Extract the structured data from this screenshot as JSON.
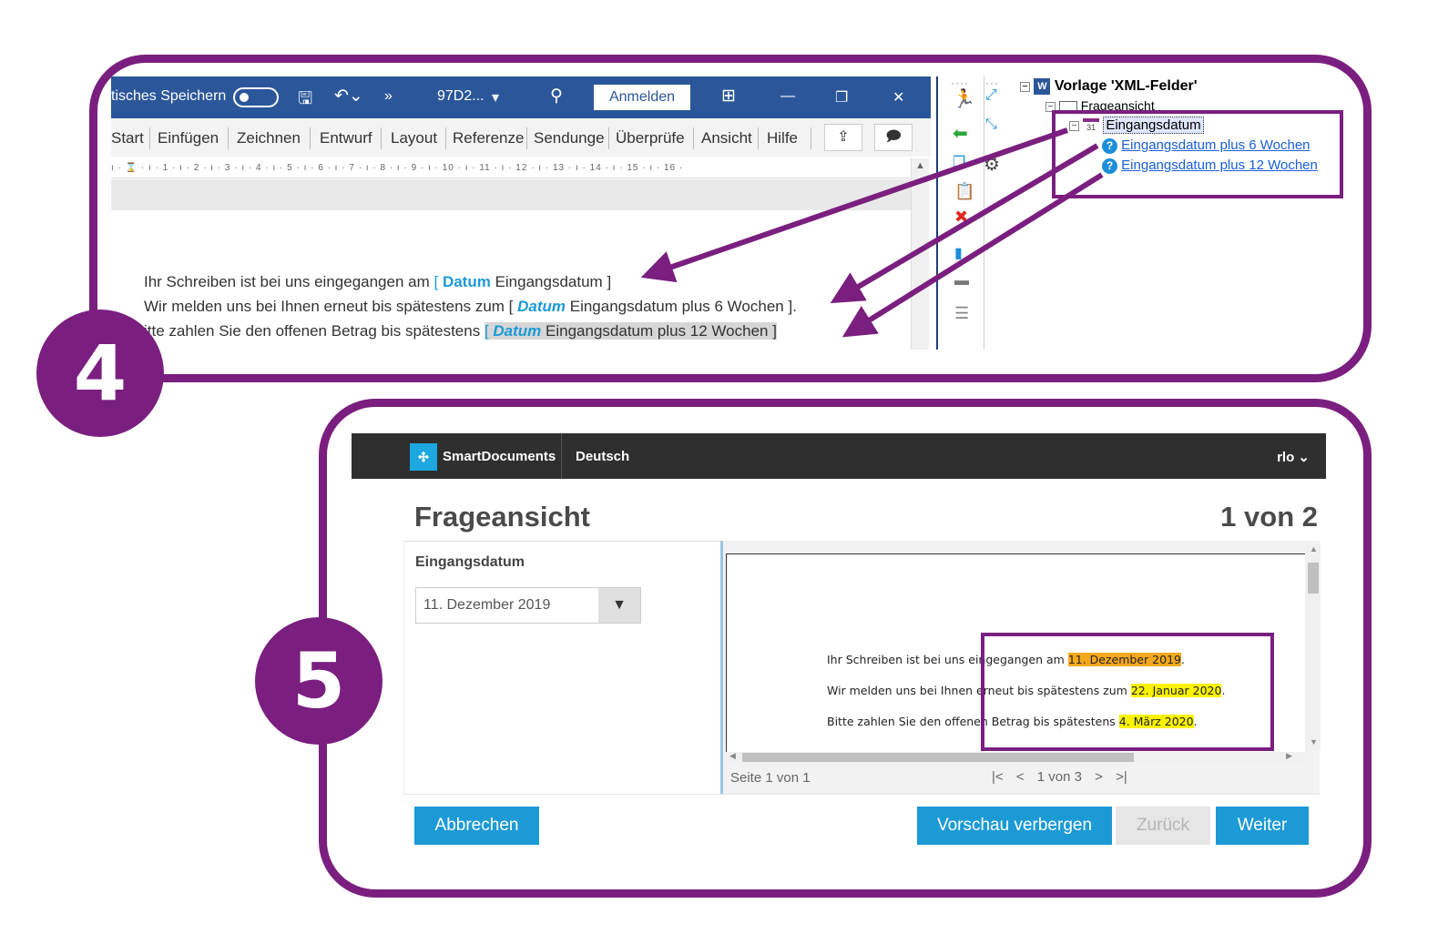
{
  "badges": {
    "step4": "4",
    "step5": "5"
  },
  "word": {
    "titlebar": {
      "autosave_label": "tisches Speichern",
      "save_icon": "save-icon",
      "undo_icon": "undo-icon",
      "more": "»",
      "doc_name": "97D2...",
      "doc_caret": "▾",
      "search_icon": "search-icon",
      "login_button": "Anmelden",
      "ribbon_display_icon": "ribbon-display-icon",
      "minimize": "—",
      "restore": "❐",
      "close": "✕"
    },
    "ribbon_tabs": [
      "Start",
      "Einfügen",
      "Zeichnen",
      "Entwurf",
      "Layout",
      "Referenze",
      "Sendunge",
      "Überprüfe",
      "Ansicht",
      "Hilfe"
    ],
    "ribbon_actions": {
      "share": "⇪",
      "comment": "🗩"
    },
    "ruler": "ı · ⌛ · ı · 1 · ı · 2 · ı · 3 · ı · 4 · ı · 5 · ı · 6 · ı · 7 · ı · 8 · ı · 9 · ı · 10 · ı · 11 · ı · 12 · ı · 13 · ı · 14 · ı · 15 · ı · 16 ·",
    "doc_lines": [
      {
        "pre": "Ihr Schreiben ist bei uns eingegangen am ",
        "open": "[ ",
        "tag": "Datum",
        "field": " Eingangsdatum ",
        "close": "]",
        "post": ""
      },
      {
        "pre": "Wir melden uns bei Ihnen erneut bis spätestens zum ",
        "open": "[ ",
        "tag": "Datum",
        "field": " Eingangsdatum plus 6 Wochen ",
        "close": "]",
        "post": "."
      },
      {
        "pre": "itte zahlen Sie den offenen Betrag bis spätestens ",
        "open": "[ ",
        "tag": "Datum",
        "field": " Eingangsdatum plus 12 Wochen ",
        "close": "]",
        "post": ""
      }
    ]
  },
  "tree": {
    "root_label": "Vorlage 'XML-Felder'",
    "child_label": "Frageansicht",
    "selected_label": "Eingangsdatum",
    "cal_text": "31",
    "items": [
      "Eingangsdatum plus 6 Wochen",
      "Eingangsdatum plus 12 Wochen"
    ]
  },
  "smartdocs": {
    "brand": "SmartDocuments",
    "language": "Deutsch",
    "user": "rlo ⌄",
    "title": "Frageansicht",
    "page_count": "1 von 2",
    "field_label": "Eingangsdatum",
    "field_value": "11. Dezember 2019",
    "dropdown_arrow": "▼",
    "preview_lines": [
      {
        "text": "Ihr Schreiben ist bei uns eingegangen am ",
        "date": "11. Dezember 2019",
        "color": "#f6a81d",
        "end": "."
      },
      {
        "text": "Wir melden uns bei Ihnen erneut bis spätestens zum ",
        "date": "22. Januar 2020",
        "color": "#f9f200",
        "end": "."
      },
      {
        "text": "Bitte zahlen Sie den offenen Betrag bis spätestens ",
        "date": "4. März 2020",
        "color": "#f9f200",
        "end": "."
      }
    ],
    "pager": {
      "page_info": "Seite 1 von 1",
      "first": "|<",
      "prev": "<",
      "current": "1 von 3",
      "next": ">",
      "last": ">|"
    },
    "buttons": {
      "cancel": "Abbrechen",
      "hide_preview": "Vorschau verbergen",
      "back": "Zurück",
      "next": "Weiter"
    }
  },
  "colors": {
    "purple": "#7a1f7f",
    "word_blue": "#2b579a",
    "accent_blue": "#1c9ad6",
    "arrow": "#7a1f7f"
  }
}
